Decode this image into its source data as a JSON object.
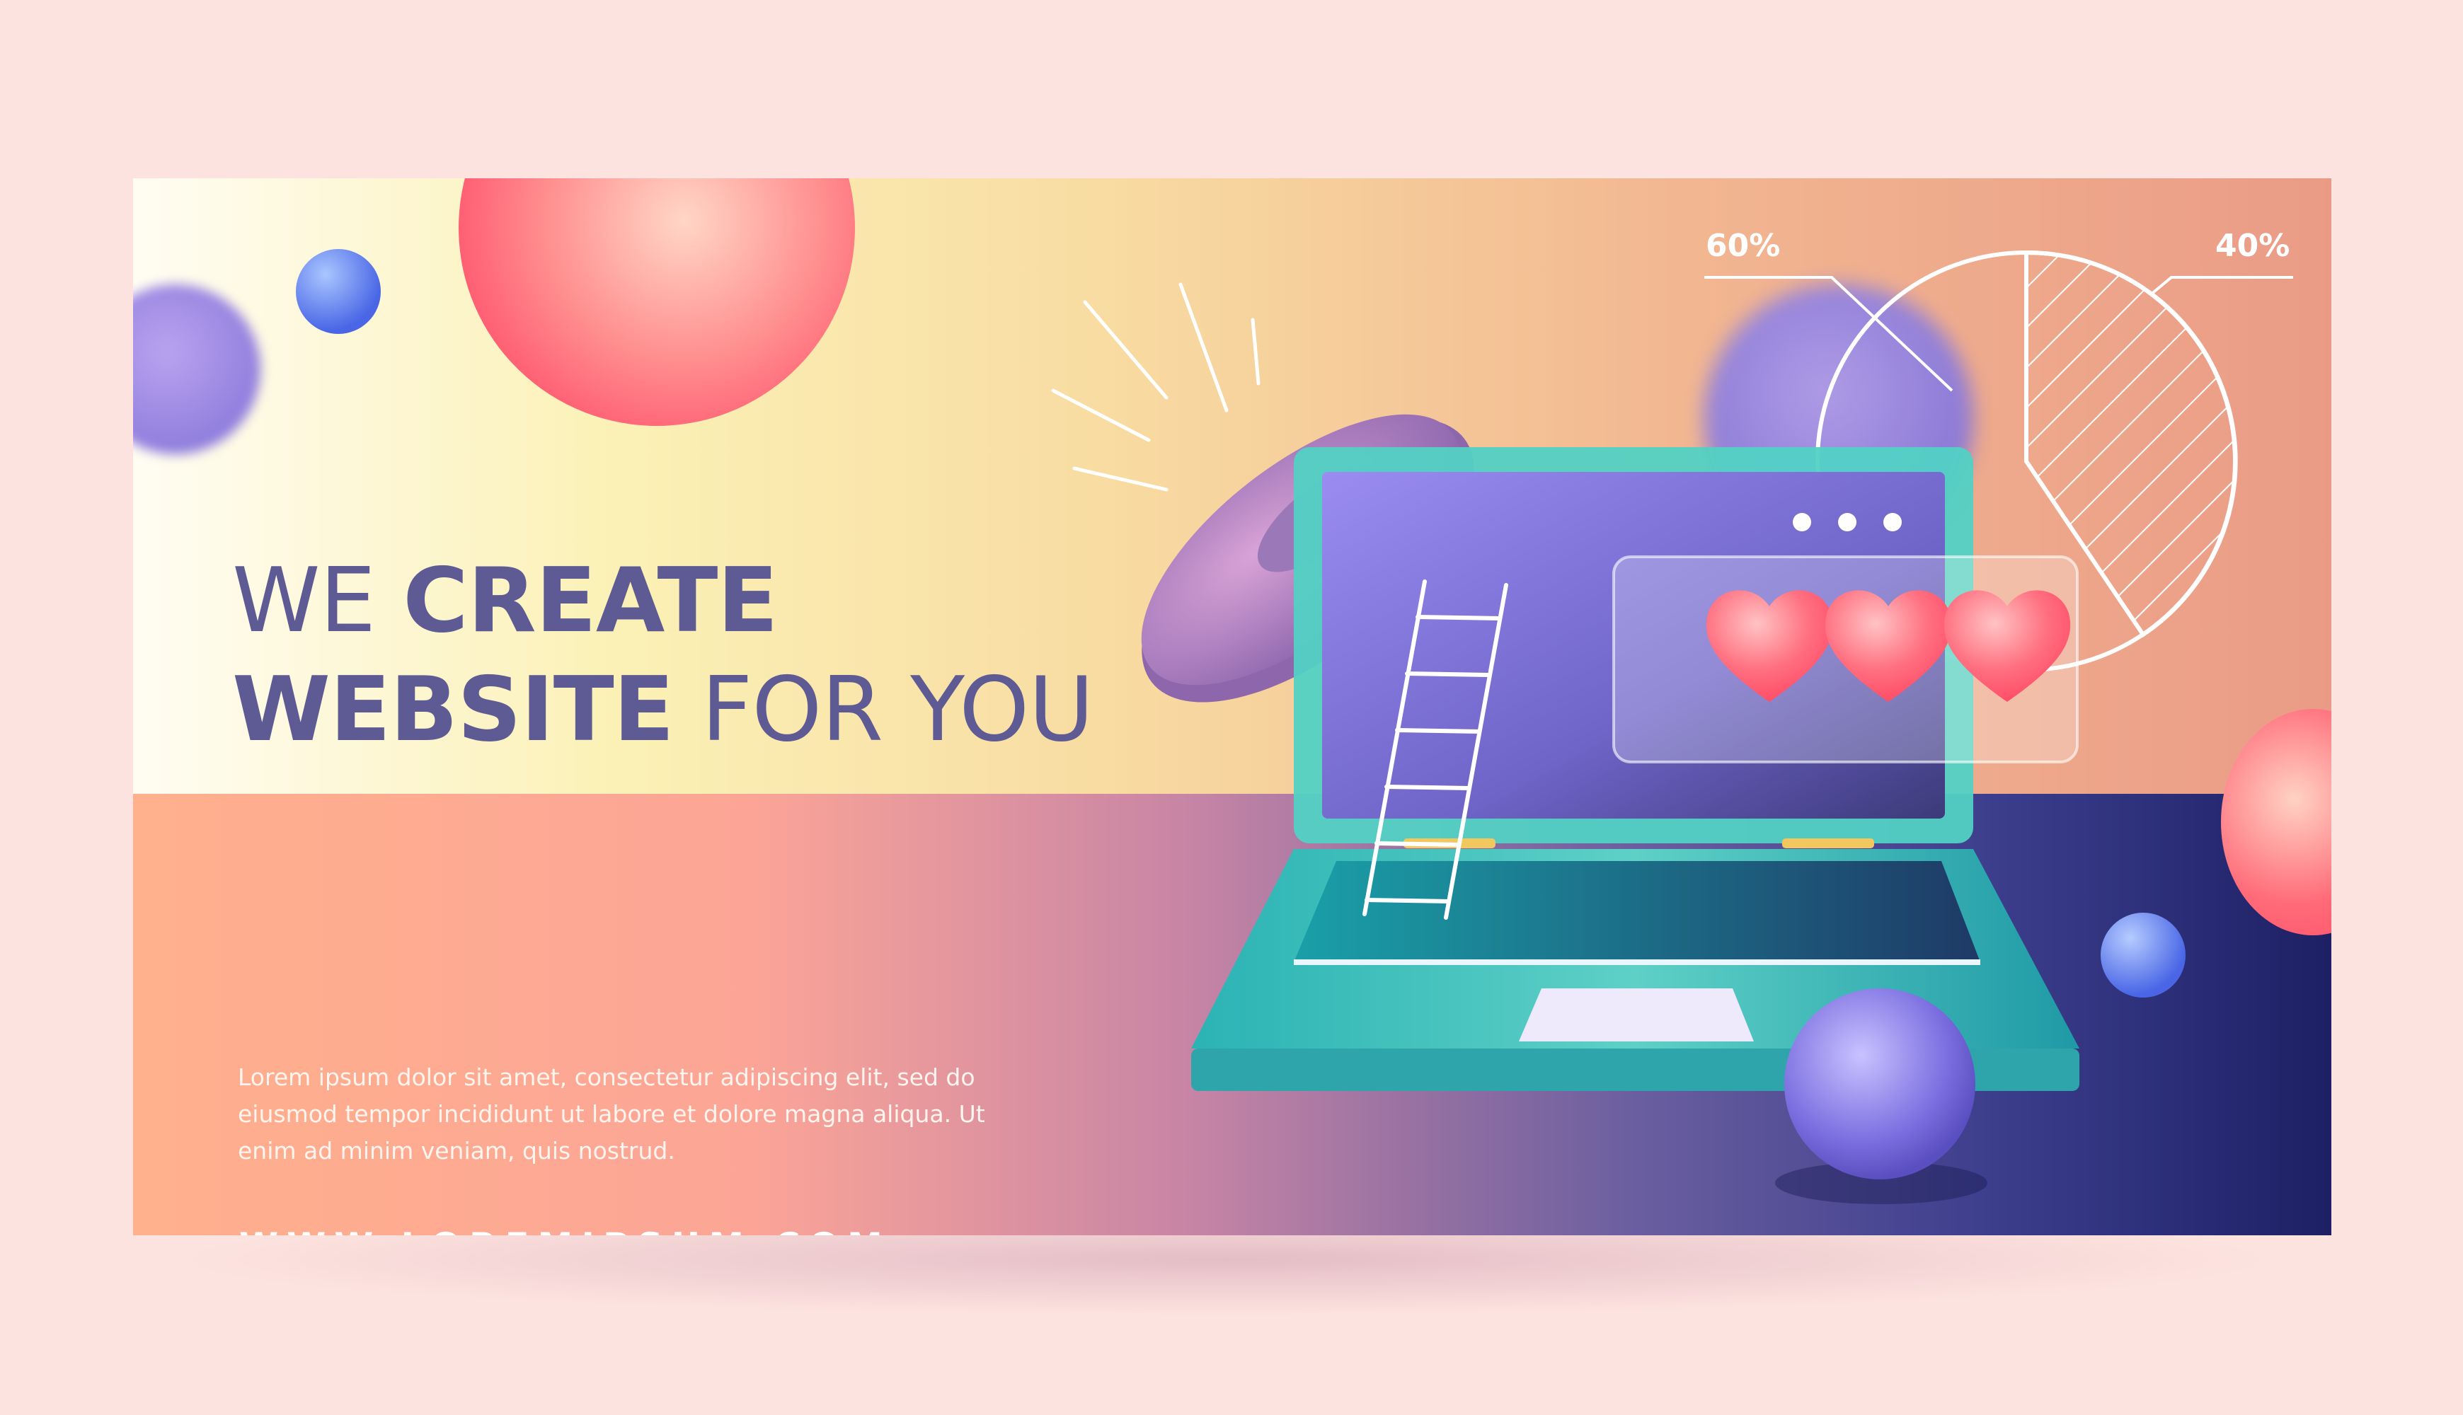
{
  "headline": {
    "line1_light": "WE",
    "line1_bold": "CREATE",
    "line2_bold": "WEBSITE",
    "line2_light": "FOR YOU"
  },
  "body_text": "Lorem ipsum dolor sit amet, consectetur adipiscing elit, sed do eiusmod tempor incididunt ut labore et dolore magna aliqua. Ut enim ad minim veniam, quis nostrud.",
  "url": "WWW.LOREMIPSUM.COM",
  "chart": {
    "left_label": "60%",
    "right_label": "40%"
  },
  "colors": {
    "heading": "#5e5b94",
    "laptop": "#1fa3ab",
    "screen": "#8a7fe0",
    "heart": "#ff5c72"
  },
  "icons": [
    "ladder-icon",
    "heart-icon",
    "ellipsis-icon",
    "pie-chart-icon",
    "laptop-icon"
  ]
}
